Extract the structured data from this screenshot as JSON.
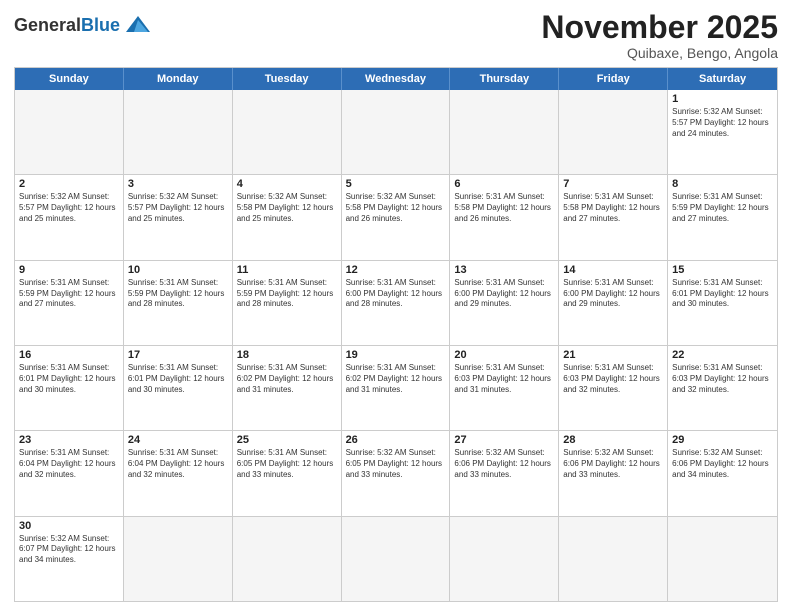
{
  "header": {
    "logo_general": "General",
    "logo_blue": "Blue",
    "month_title": "November 2025",
    "location": "Quibaxe, Bengo, Angola"
  },
  "days_of_week": [
    "Sunday",
    "Monday",
    "Tuesday",
    "Wednesday",
    "Thursday",
    "Friday",
    "Saturday"
  ],
  "weeks": [
    [
      {
        "day": "",
        "info": "",
        "empty": true
      },
      {
        "day": "",
        "info": "",
        "empty": true
      },
      {
        "day": "",
        "info": "",
        "empty": true
      },
      {
        "day": "",
        "info": "",
        "empty": true
      },
      {
        "day": "",
        "info": "",
        "empty": true
      },
      {
        "day": "",
        "info": "",
        "empty": true
      },
      {
        "day": "1",
        "info": "Sunrise: 5:32 AM\nSunset: 5:57 PM\nDaylight: 12 hours\nand 24 minutes.",
        "empty": false
      }
    ],
    [
      {
        "day": "2",
        "info": "Sunrise: 5:32 AM\nSunset: 5:57 PM\nDaylight: 12 hours\nand 25 minutes.",
        "empty": false
      },
      {
        "day": "3",
        "info": "Sunrise: 5:32 AM\nSunset: 5:57 PM\nDaylight: 12 hours\nand 25 minutes.",
        "empty": false
      },
      {
        "day": "4",
        "info": "Sunrise: 5:32 AM\nSunset: 5:58 PM\nDaylight: 12 hours\nand 25 minutes.",
        "empty": false
      },
      {
        "day": "5",
        "info": "Sunrise: 5:32 AM\nSunset: 5:58 PM\nDaylight: 12 hours\nand 26 minutes.",
        "empty": false
      },
      {
        "day": "6",
        "info": "Sunrise: 5:31 AM\nSunset: 5:58 PM\nDaylight: 12 hours\nand 26 minutes.",
        "empty": false
      },
      {
        "day": "7",
        "info": "Sunrise: 5:31 AM\nSunset: 5:58 PM\nDaylight: 12 hours\nand 27 minutes.",
        "empty": false
      },
      {
        "day": "8",
        "info": "Sunrise: 5:31 AM\nSunset: 5:59 PM\nDaylight: 12 hours\nand 27 minutes.",
        "empty": false
      }
    ],
    [
      {
        "day": "9",
        "info": "Sunrise: 5:31 AM\nSunset: 5:59 PM\nDaylight: 12 hours\nand 27 minutes.",
        "empty": false
      },
      {
        "day": "10",
        "info": "Sunrise: 5:31 AM\nSunset: 5:59 PM\nDaylight: 12 hours\nand 28 minutes.",
        "empty": false
      },
      {
        "day": "11",
        "info": "Sunrise: 5:31 AM\nSunset: 5:59 PM\nDaylight: 12 hours\nand 28 minutes.",
        "empty": false
      },
      {
        "day": "12",
        "info": "Sunrise: 5:31 AM\nSunset: 6:00 PM\nDaylight: 12 hours\nand 28 minutes.",
        "empty": false
      },
      {
        "day": "13",
        "info": "Sunrise: 5:31 AM\nSunset: 6:00 PM\nDaylight: 12 hours\nand 29 minutes.",
        "empty": false
      },
      {
        "day": "14",
        "info": "Sunrise: 5:31 AM\nSunset: 6:00 PM\nDaylight: 12 hours\nand 29 minutes.",
        "empty": false
      },
      {
        "day": "15",
        "info": "Sunrise: 5:31 AM\nSunset: 6:01 PM\nDaylight: 12 hours\nand 30 minutes.",
        "empty": false
      }
    ],
    [
      {
        "day": "16",
        "info": "Sunrise: 5:31 AM\nSunset: 6:01 PM\nDaylight: 12 hours\nand 30 minutes.",
        "empty": false
      },
      {
        "day": "17",
        "info": "Sunrise: 5:31 AM\nSunset: 6:01 PM\nDaylight: 12 hours\nand 30 minutes.",
        "empty": false
      },
      {
        "day": "18",
        "info": "Sunrise: 5:31 AM\nSunset: 6:02 PM\nDaylight: 12 hours\nand 31 minutes.",
        "empty": false
      },
      {
        "day": "19",
        "info": "Sunrise: 5:31 AM\nSunset: 6:02 PM\nDaylight: 12 hours\nand 31 minutes.",
        "empty": false
      },
      {
        "day": "20",
        "info": "Sunrise: 5:31 AM\nSunset: 6:03 PM\nDaylight: 12 hours\nand 31 minutes.",
        "empty": false
      },
      {
        "day": "21",
        "info": "Sunrise: 5:31 AM\nSunset: 6:03 PM\nDaylight: 12 hours\nand 32 minutes.",
        "empty": false
      },
      {
        "day": "22",
        "info": "Sunrise: 5:31 AM\nSunset: 6:03 PM\nDaylight: 12 hours\nand 32 minutes.",
        "empty": false
      }
    ],
    [
      {
        "day": "23",
        "info": "Sunrise: 5:31 AM\nSunset: 6:04 PM\nDaylight: 12 hours\nand 32 minutes.",
        "empty": false
      },
      {
        "day": "24",
        "info": "Sunrise: 5:31 AM\nSunset: 6:04 PM\nDaylight: 12 hours\nand 32 minutes.",
        "empty": false
      },
      {
        "day": "25",
        "info": "Sunrise: 5:31 AM\nSunset: 6:05 PM\nDaylight: 12 hours\nand 33 minutes.",
        "empty": false
      },
      {
        "day": "26",
        "info": "Sunrise: 5:32 AM\nSunset: 6:05 PM\nDaylight: 12 hours\nand 33 minutes.",
        "empty": false
      },
      {
        "day": "27",
        "info": "Sunrise: 5:32 AM\nSunset: 6:06 PM\nDaylight: 12 hours\nand 33 minutes.",
        "empty": false
      },
      {
        "day": "28",
        "info": "Sunrise: 5:32 AM\nSunset: 6:06 PM\nDaylight: 12 hours\nand 33 minutes.",
        "empty": false
      },
      {
        "day": "29",
        "info": "Sunrise: 5:32 AM\nSunset: 6:06 PM\nDaylight: 12 hours\nand 34 minutes.",
        "empty": false
      }
    ],
    [
      {
        "day": "30",
        "info": "Sunrise: 5:32 AM\nSunset: 6:07 PM\nDaylight: 12 hours\nand 34 minutes.",
        "empty": false
      },
      {
        "day": "",
        "info": "",
        "empty": true
      },
      {
        "day": "",
        "info": "",
        "empty": true
      },
      {
        "day": "",
        "info": "",
        "empty": true
      },
      {
        "day": "",
        "info": "",
        "empty": true
      },
      {
        "day": "",
        "info": "",
        "empty": true
      },
      {
        "day": "",
        "info": "",
        "empty": true
      }
    ]
  ]
}
